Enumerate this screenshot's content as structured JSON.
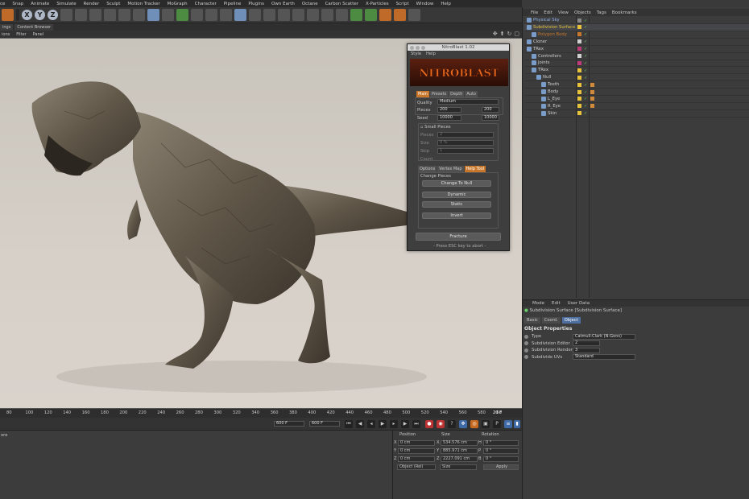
{
  "menubar": [
    "ce",
    "Snap",
    "Animate",
    "Simulate",
    "Render",
    "Sculpt",
    "Motion Tracker",
    "MoGraph",
    "Character",
    "Pipeline",
    "Plugins",
    "Own Earth",
    "Octane",
    "Carbon Scatter",
    "X-Particles",
    "Script",
    "Window",
    "Help"
  ],
  "toolbar": {
    "xyz": [
      "X",
      "Y",
      "Z"
    ]
  },
  "view_tabs": [
    "ings",
    "Content Browser"
  ],
  "view_menu": [
    "ions",
    "Filter",
    "Panel"
  ],
  "view_icons": [
    "✥",
    "⬆",
    "↻",
    "▢"
  ],
  "object_manager": {
    "menu": [
      "File",
      "Edit",
      "View",
      "Objects",
      "Tags",
      "Bookmarks"
    ],
    "rows": [
      {
        "name": "Physical Sky",
        "indent": 0,
        "color": "#8fb3e8"
      },
      {
        "name": "Subdivision Surface",
        "indent": 0,
        "color": "#e8c23a"
      },
      {
        "name": "Polygon Body",
        "indent": 1,
        "color": "#c7762a"
      },
      {
        "name": "Cloner",
        "indent": 0,
        "color": "#cfcfcf"
      },
      {
        "name": "TRex",
        "indent": 0,
        "color": "#cfcfcf"
      },
      {
        "name": "Controllers",
        "indent": 1,
        "color": "#cfcfcf"
      },
      {
        "name": "Joints",
        "indent": 1,
        "color": "#cfcfcf"
      },
      {
        "name": "TRex",
        "indent": 1,
        "color": "#cfcfcf"
      },
      {
        "name": "Null",
        "indent": 2,
        "color": "#cfcfcf"
      },
      {
        "name": "Teeth",
        "indent": 3,
        "color": "#cfcfcf"
      },
      {
        "name": "Body",
        "indent": 3,
        "color": "#cfcfcf"
      },
      {
        "name": "L_Eye",
        "indent": 3,
        "color": "#cfcfcf"
      },
      {
        "name": "R_Eye",
        "indent": 3,
        "color": "#cfcfcf"
      },
      {
        "name": "Skin",
        "indent": 3,
        "color": "#cfcfcf"
      }
    ]
  },
  "attributes": {
    "menu": [
      "Mode",
      "Edit",
      "User Data"
    ],
    "title": "Subdivision Surface [Subdivision Surface]",
    "tabs": [
      "Basic",
      "Coord.",
      "Object"
    ],
    "section": "Object Properties",
    "rows": [
      {
        "label": "Type",
        "value": "Catmull-Clark (N-Gons)"
      },
      {
        "label": "Subdivision Editor",
        "value": "2"
      },
      {
        "label": "Subdivision Renderer",
        "value": "3"
      },
      {
        "label": "Subdivide UVs",
        "value": "Standard"
      }
    ]
  },
  "nitroblast": {
    "title": "NitroBlast 1.02",
    "menu": [
      "Style",
      "Help"
    ],
    "logo": "NITROBLAST",
    "tabs": [
      "Main",
      "Presets",
      "Depth",
      "Auto"
    ],
    "quality_label": "Quality",
    "quality_value": "Medium",
    "pieces_label": "Pieces",
    "pieces_min": "200",
    "pieces_max": "200",
    "seed_label": "Seed",
    "seed_min": "10000",
    "seed_max": "10000",
    "small_pieces_label": "Small Pieces",
    "sp_pieces": "Pieces",
    "sp_pieces_value": "2",
    "sp_size": "Size",
    "sp_size_value": "0 %",
    "sp_skip": "Skip",
    "sp_skip_value": "1",
    "sp_count": "Count",
    "subtabs": [
      "Options",
      "Vertex Map",
      "Help Tool"
    ],
    "change_pieces": "Change Pieces",
    "buttons": [
      "Change To Null",
      "Dynamic",
      "Static",
      "Invert"
    ],
    "fracture": "Fracture",
    "esc_note": "- Press ESC key to abort -"
  },
  "timeline": {
    "ticks": [
      "80",
      "100",
      "120",
      "140",
      "160",
      "180",
      "200",
      "220",
      "240",
      "260",
      "280",
      "300",
      "320",
      "340",
      "360",
      "380",
      "400",
      "420",
      "440",
      "460",
      "480",
      "500",
      "520",
      "540",
      "560",
      "580",
      "60"
    ],
    "current": "20 F",
    "start": "600 F",
    "end": "600 F"
  },
  "coordinates": {
    "headers": [
      "Position",
      "Size",
      "Rotation"
    ],
    "rows": [
      {
        "axis": "X",
        "pos": "0 cm",
        "size": "534.576 cm",
        "rot_axis": "H",
        "rot": "0 °"
      },
      {
        "axis": "Y",
        "pos": "0 cm",
        "size": "885.971 cm",
        "rot_axis": "P",
        "rot": "0 °"
      },
      {
        "axis": "Z",
        "pos": "0 cm",
        "size": "2227.091 cm",
        "rot_axis": "B",
        "rot": "0 °"
      }
    ],
    "mode": "Object (Rel)",
    "size_mode": "Size",
    "apply": "Apply"
  },
  "bottom_left_label": "ore"
}
